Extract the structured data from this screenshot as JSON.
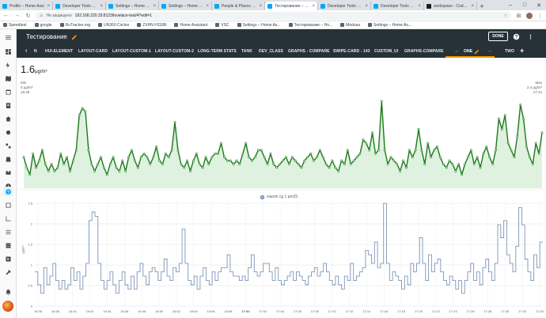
{
  "browser": {
    "tabs": [
      {
        "title": "Profile – Home Assi",
        "fav": "ha"
      },
      {
        "title": "Developer Tools – Ho",
        "fav": "ha"
      },
      {
        "title": "Settings – Home Assi",
        "fav": "ha"
      },
      {
        "title": "Settings – Home Assi",
        "fav": "ha"
      },
      {
        "title": "People & Places – Ho",
        "fav": "ha"
      },
      {
        "title": "Тестирование – Hom",
        "fav": "ha",
        "active": true
      },
      {
        "title": "Developer Tools – Ho",
        "fav": "ha"
      },
      {
        "title": "Developer Tools – Ho",
        "fav": "ha"
      },
      {
        "title": "workspace - Code - O",
        "fav": "code"
      }
    ],
    "security_label": "Не защищено",
    "url": "192.168.220.33:8123/lovelace-test/4?edit=1",
    "bookmarks": [
      "Speedtest",
      "google",
      "RuTracker.org",
      "UN360 Circles",
      "ZXHN H118N",
      "Home Assistant",
      "VSC",
      "Settings – Home As...",
      "Тестирование – Ho...",
      "Medusa",
      "Settings – Home As..."
    ]
  },
  "header": {
    "title": "Тестирование",
    "done_label": "DONE",
    "tabs": [
      "N",
      "HUI-ELEMENT",
      "LAYOUT-CARD",
      "LAYOUT-CUSTOM-1",
      "LAYOUT-CUSTOM-2",
      "LONG-TERM STATS",
      "TANK",
      "DEV_CLASS",
      "GRAPHS - COMPARE",
      "SWIPE-CARD - 143",
      "CUSTOM_UI",
      "GRAPHS-COMPARE",
      "ONE",
      "TWO"
    ],
    "active_tab": "ONE"
  },
  "sensor_card": {
    "value": "1.6",
    "unit": "μg/m³",
    "min_label": "Min",
    "min_value": "0 μg/m³",
    "min_time": "16:49",
    "max_label": "Max",
    "max_value": "2.4 μg/m³",
    "max_time": "17:14"
  },
  "history_card": {
    "legend": "xiaomi cg 1 pm25",
    "y_axis_label": "μg/m³"
  },
  "colors": {
    "accent": "#03a9f4",
    "header_bg": "#263238",
    "tab_highlight": "#ff9800",
    "line_green": "#1b7a1b",
    "fill_green": "#dff1df",
    "step_blue": "#7d96b8"
  },
  "chart_data": [
    {
      "type": "line",
      "title": "",
      "values": [
        0.8,
        0.5,
        0.3,
        0.9,
        0.5,
        0.7,
        1.0,
        0.6,
        0.4,
        0.6,
        0.4,
        0.5,
        0.9,
        0.6,
        0.8,
        0.4,
        0.7,
        1.0,
        2.0,
        2.2,
        2.1,
        1.0,
        0.6,
        0.4,
        0.6,
        0.8,
        0.5,
        0.3,
        0.6,
        0.8,
        0.5,
        0.4,
        0.7,
        0.4,
        0.8,
        1.0,
        0.7,
        0.5,
        0.8,
        0.9,
        0.8,
        0.6,
        0.8,
        1.1,
        0.7,
        0.6,
        0.9,
        0.8,
        1.0,
        1.8,
        1.0,
        0.6,
        0.5,
        0.7,
        0.4,
        0.7,
        0.9,
        0.6,
        0.5,
        0.8,
        0.6,
        0.8,
        0.9,
        0.9,
        1.2,
        0.8,
        0.7,
        0.7,
        0.6,
        0.7,
        0.6,
        0.9,
        1.2,
        0.8,
        0.7,
        0.8,
        1.0,
        1.0,
        0.8,
        0.6,
        0.9,
        0.6,
        0.5,
        0.6,
        0.7,
        0.8,
        0.6,
        0.8,
        0.7,
        0.6,
        0.5,
        0.7,
        0.8,
        0.9,
        0.7,
        0.8,
        1.0,
        0.8,
        0.6,
        0.5,
        0.7,
        0.5,
        0.4,
        0.7,
        0.6,
        1.0,
        0.6,
        0.7,
        0.8,
        0.9,
        1.3,
        1.2,
        1.0,
        1.5,
        0.9,
        1.0,
        2.4,
        1.0,
        0.6,
        0.8,
        0.7,
        0.6,
        0.4,
        0.7,
        0.5,
        1.0,
        0.8,
        1.0,
        1.6,
        1.0,
        0.6,
        1.2,
        0.8,
        1.0,
        1.1,
        0.8,
        0.6,
        0.5,
        0.7,
        0.6,
        0.4,
        0.6,
        0.3,
        0.6,
        0.8,
        1.0,
        0.6,
        0.8,
        0.5,
        0.9,
        1.1,
        0.8,
        0.6,
        1.0,
        1.9,
        1.6,
        2.0,
        1.2,
        1.0,
        0.8,
        1.4,
        2.3,
        1.9,
        1.1,
        0.8,
        0.6,
        1.2,
        0.9,
        1.5
      ],
      "ylim": [
        0,
        2.4
      ]
    },
    {
      "type": "line",
      "title": "",
      "series": [
        {
          "name": "xiaomi cg 1 pm25"
        }
      ],
      "step": true,
      "x_ticks": [
        "16:36",
        "16:38",
        "16:40",
        "16:42",
        "16:44",
        "16:46",
        "16:48",
        "16:50",
        "16:52",
        "16:54",
        "16:56",
        "16:58",
        "17:00",
        "17:02",
        "17:04",
        "17:06",
        "17:08",
        "17:10",
        "17:12",
        "17:14",
        "17:16",
        "17:18",
        "17:20",
        "17:22",
        "17:24",
        "17:26",
        "17:28",
        "17:30",
        "17:32",
        "17:34"
      ],
      "y_ticks": [
        "0",
        "0.5",
        "1",
        "1.5",
        "2",
        "2.5"
      ],
      "ylim": [
        0,
        2.5
      ],
      "ylabel": "μg/m³"
    }
  ]
}
